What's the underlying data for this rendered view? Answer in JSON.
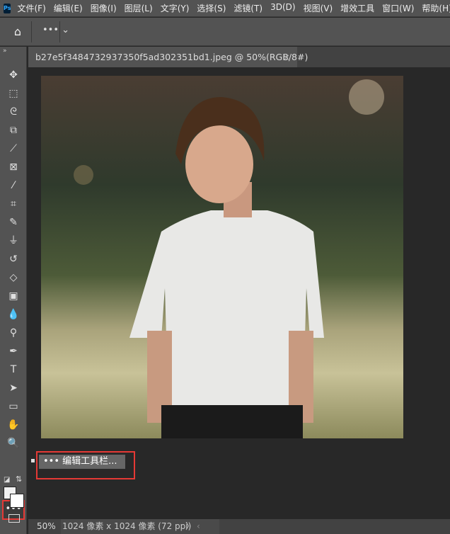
{
  "app": {
    "logo": "Ps"
  },
  "menu": [
    "文件(F)",
    "编辑(E)",
    "图像(I)",
    "图层(L)",
    "文字(Y)",
    "选择(S)",
    "滤镜(T)",
    "3D(D)",
    "视图(V)",
    "增效工具",
    "窗口(W)",
    "帮助(H)"
  ],
  "options": {
    "home_icon": "⌂",
    "more_label": "••• ⌄"
  },
  "document": {
    "tab_title": "b27e5f3484732937350f5ad302351bd1.jpeg @ 50%(RGB/8#)",
    "close": "×"
  },
  "tools": [
    {
      "name": "move-tool",
      "glyph": "✥"
    },
    {
      "name": "marquee-tool",
      "glyph": "⬚"
    },
    {
      "name": "lasso-tool",
      "glyph": "ᘓ"
    },
    {
      "name": "object-selection-tool",
      "glyph": "⧉"
    },
    {
      "name": "slice-tool",
      "glyph": "⟋"
    },
    {
      "name": "frame-tool",
      "glyph": "⊠"
    },
    {
      "name": "eyedropper-tool",
      "glyph": "⁄"
    },
    {
      "name": "healing-tool",
      "glyph": "⌗"
    },
    {
      "name": "brush-tool",
      "glyph": "✎"
    },
    {
      "name": "stamp-tool",
      "glyph": "⏚"
    },
    {
      "name": "history-brush-tool",
      "glyph": "↺"
    },
    {
      "name": "eraser-tool",
      "glyph": "◇"
    },
    {
      "name": "gradient-tool",
      "glyph": "▣"
    },
    {
      "name": "blur-tool",
      "glyph": "💧"
    },
    {
      "name": "dodge-tool",
      "glyph": "⚲"
    },
    {
      "name": "pen-tool",
      "glyph": "✒"
    },
    {
      "name": "type-tool",
      "glyph": "T"
    },
    {
      "name": "path-selection-tool",
      "glyph": "➤"
    },
    {
      "name": "rectangle-tool",
      "glyph": "▭"
    },
    {
      "name": "hand-tool",
      "glyph": "✋"
    },
    {
      "name": "zoom-tool",
      "glyph": "🔍"
    }
  ],
  "more_tool": "•••",
  "popup": {
    "label": "••• 编辑工具栏..."
  },
  "status": {
    "zoom": "50%",
    "info": "1024 像素 x 1024 像素 (72 ppi)",
    "arrow": "〉",
    "scroll": "‹"
  }
}
